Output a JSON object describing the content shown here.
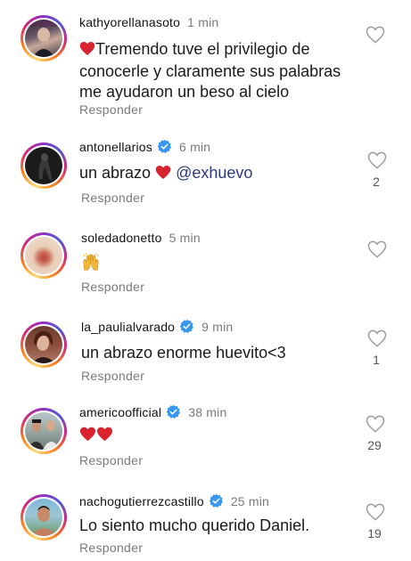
{
  "reply_label": "Responder",
  "colors": {
    "verified": "#3897f0",
    "heart_emoji": "#d9232f",
    "mention": "#2d3a7a",
    "muted_text": "#7a7a7a"
  },
  "comments": [
    {
      "username": "kathyorellanasoto",
      "verified": false,
      "time": "1 min",
      "text_parts": [
        "Tremendo tuve el privilegio de",
        "conocerle y claramente sus palabras",
        "me ayudaron un beso al cielo"
      ],
      "leading_emoji": "red-heart",
      "like_count": ""
    },
    {
      "username": "antonellarios",
      "verified": true,
      "time": "6 min",
      "text_before": "un abrazo",
      "emoji": "red-heart",
      "mention": "@exhuevo",
      "like_count": "2"
    },
    {
      "username": "soledadonetto",
      "verified": false,
      "time": "5 min",
      "emoji": "raising-hands",
      "like_count": ""
    },
    {
      "username": "la_paulialvarado",
      "verified": true,
      "time": "9 min",
      "text": "un abrazo enorme huevito<3",
      "like_count": "1"
    },
    {
      "username": "americoofficial",
      "verified": true,
      "time": "38 min",
      "emoji": "two-red-hearts",
      "like_count": "29"
    },
    {
      "username": "nachogutierrezcastillo",
      "verified": true,
      "time": "25 min",
      "text": "Lo siento mucho querido Daniel.",
      "like_count": "19"
    }
  ]
}
